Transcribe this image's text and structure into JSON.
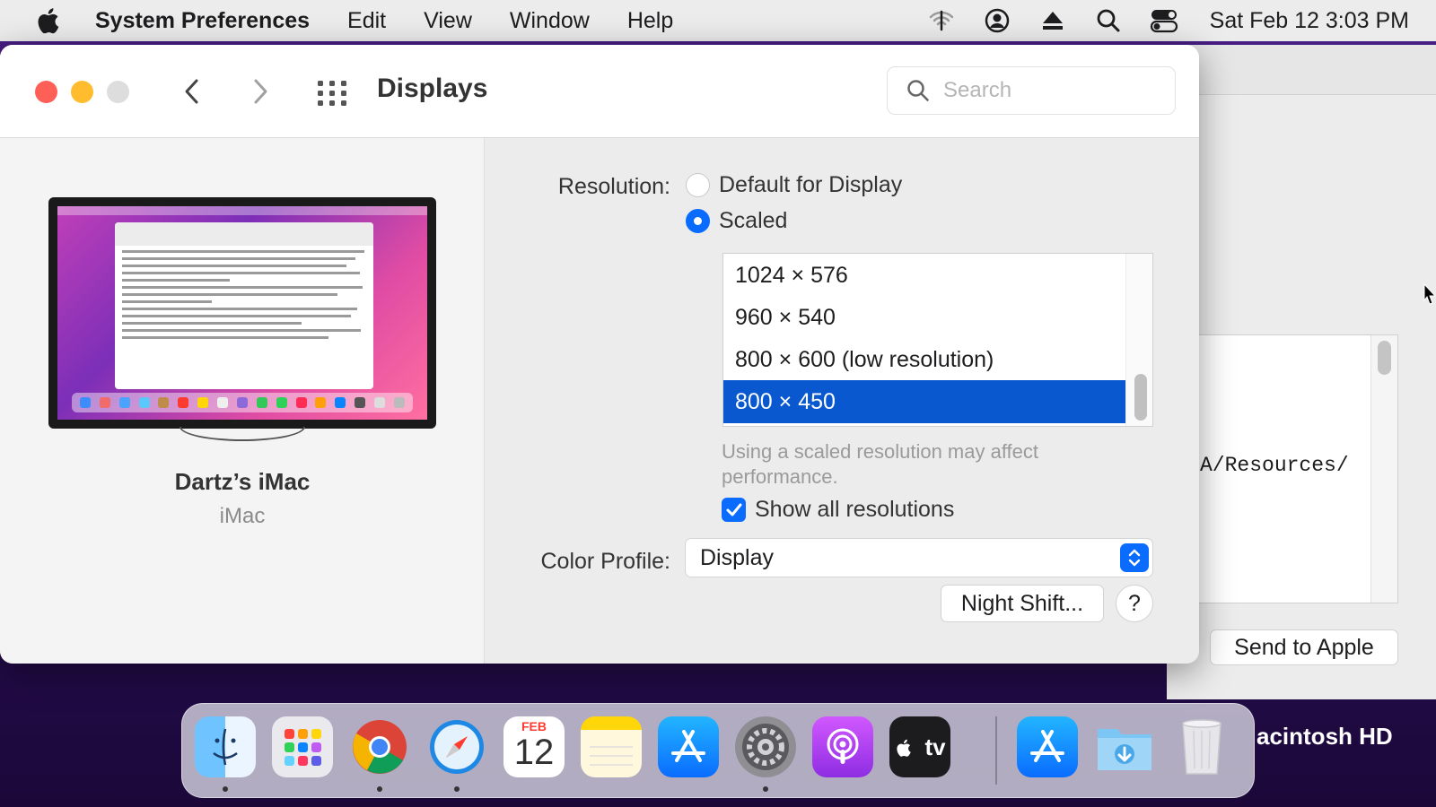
{
  "menubar": {
    "app_name": "System Preferences",
    "menus": [
      "Edit",
      "View",
      "Window",
      "Help"
    ],
    "clock": "Sat Feb 12  3:03 PM"
  },
  "window": {
    "title": "Displays",
    "search_placeholder": "Search"
  },
  "device": {
    "name": "Dartz’s iMac",
    "model": "iMac"
  },
  "display_settings": {
    "resolution_label": "Resolution:",
    "radio_options": [
      {
        "label": "Default for Display",
        "selected": false
      },
      {
        "label": "Scaled",
        "selected": true
      }
    ],
    "resolutions": [
      "1024 × 576",
      "960 × 540",
      "800 × 600 (low resolution)",
      "800 × 450"
    ],
    "selected_resolution": "800 × 450",
    "scaled_note": "Using a scaled resolution may affect performance.",
    "show_all_label": "Show all resolutions",
    "show_all_checked": true,
    "color_profile_label": "Color Profile:",
    "color_profile_value": "Display",
    "night_shift_button": "Night Shift...",
    "help_button": "?"
  },
  "background_window": {
    "path_text": "A/Resources/",
    "send_button": "Send to Apple"
  },
  "desktop": {
    "disk_label": "acintosh HD"
  },
  "dock": {
    "calendar_month": "FEB",
    "calendar_day": "12",
    "apps": [
      "Finder",
      "Launchpad",
      "Chrome",
      "Safari",
      "Calendar",
      "Notes",
      "App Store",
      "System Preferences",
      "Podcasts",
      "Apple TV",
      "App Store Downloads",
      "Downloads",
      "Trash"
    ],
    "appletv_label": "tv"
  },
  "colors": {
    "accent": "#0a6cff",
    "selection": "#0a58d0",
    "close": "#fe5f57",
    "minimize": "#febc2e"
  }
}
